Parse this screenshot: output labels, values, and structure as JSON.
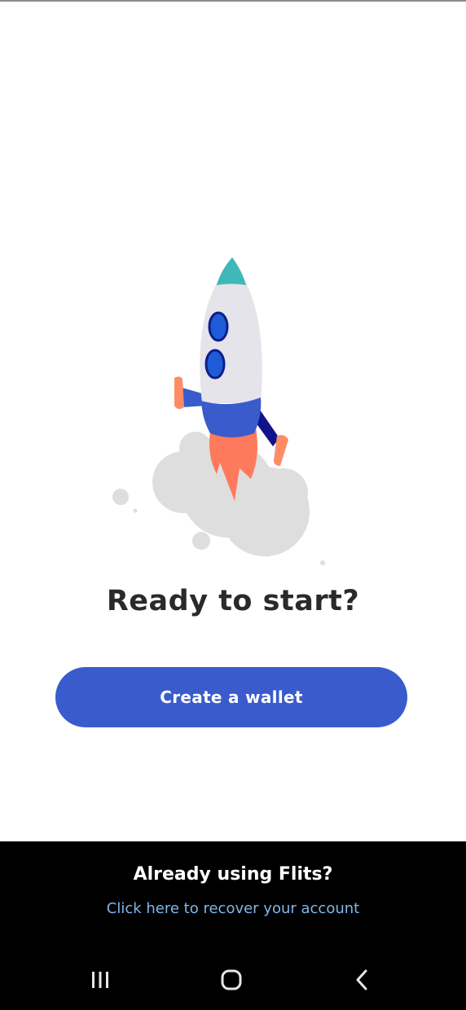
{
  "onboarding": {
    "title": "Ready to start?",
    "create_button_label": "Create a wallet"
  },
  "footer": {
    "already_using": "Already using Flits?",
    "recover_link": "Click here to recover your account"
  },
  "colors": {
    "primary": "#3a5bcc",
    "link": "#7fb6ea",
    "rocket_tip": "#3fb8b8",
    "rocket_body": "#e4e4ea",
    "window": "#1f5bd6",
    "flame": "#ff7a5c",
    "cloud": "#dedede"
  },
  "icons": {
    "rocket": "rocket-illustration",
    "nav_recents": "recents-icon",
    "nav_home": "home-icon",
    "nav_back": "back-icon"
  }
}
